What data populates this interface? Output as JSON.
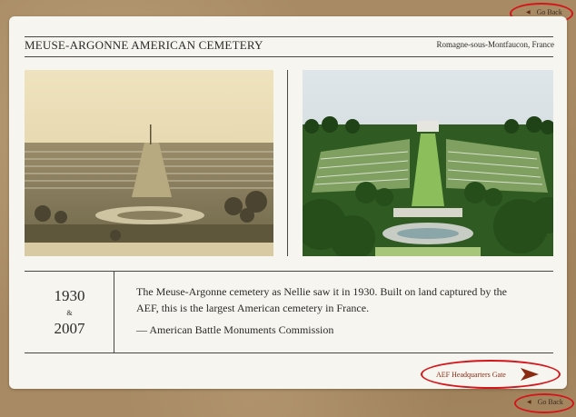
{
  "nav": {
    "back_label_top": "Go Back",
    "back_label_bottom": "Go Back",
    "next_label": "AEF Headquarters Gate"
  },
  "header": {
    "title": "MEUSE-ARGONNE AMERICAN CEMETERY",
    "location": "Romagne-sous-Montfaucon, France"
  },
  "photos": [
    {
      "name": "cemetery-1930-photo",
      "style": "sepia"
    },
    {
      "name": "cemetery-2007-photo",
      "style": "color"
    }
  ],
  "years": {
    "first": "1930",
    "connector": "&",
    "second": "2007"
  },
  "caption": {
    "text": "The Meuse-Argonne cemetery as Nellie saw it in 1930. Built on land captured by the AEF, this is the largest American cemetery in France.",
    "credit": "— American Battle Monuments Commission"
  },
  "colors": {
    "background": "#a88b64",
    "card": "#f7f5f0",
    "highlight": "#d4161a",
    "accent": "#8b2a10"
  }
}
